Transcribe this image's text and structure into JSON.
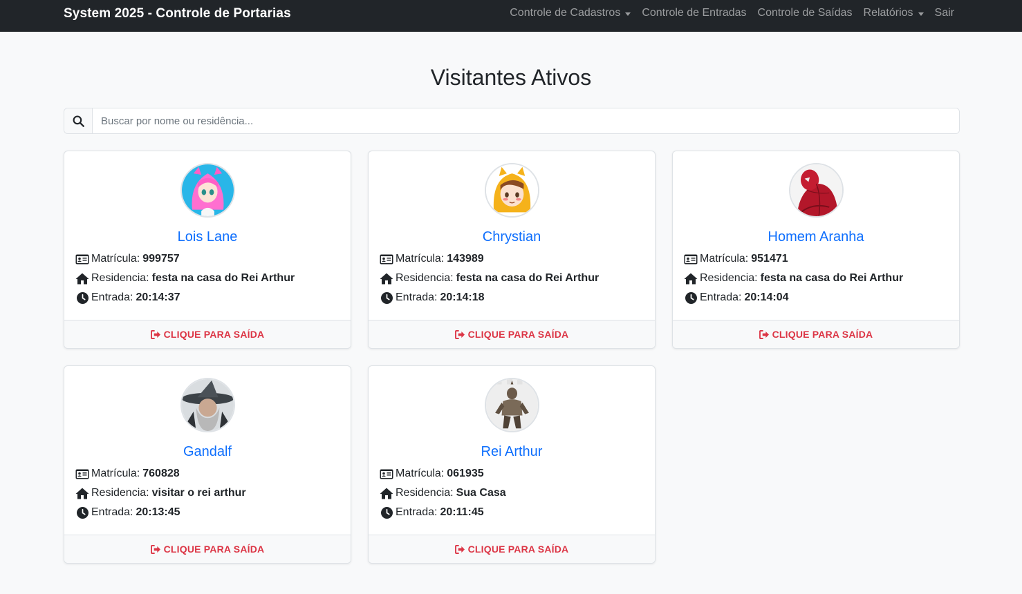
{
  "navbar": {
    "brand": "System 2025 - Controle de Portarias",
    "links": [
      {
        "label": "Controle de Cadastros",
        "dropdown": true
      },
      {
        "label": "Controle de Entradas",
        "dropdown": false
      },
      {
        "label": "Controle de Saídas",
        "dropdown": false
      },
      {
        "label": "Relatórios",
        "dropdown": true
      },
      {
        "label": "Sair",
        "dropdown": false
      }
    ]
  },
  "page": {
    "title": "Visitantes Ativos"
  },
  "search": {
    "placeholder": "Buscar por nome ou residência...",
    "value": ""
  },
  "labels": {
    "matricula": "Matrícula:",
    "residencia": "Residencia:",
    "entrada": "Entrada:",
    "exit_button": "CLIQUE PARA SAÍDA"
  },
  "visitors": [
    {
      "name": "Lois Lane",
      "matricula": "999757",
      "residencia": "festa na casa do Rei Arthur",
      "entrada": "20:14:37",
      "avatar": "pink-hair-character"
    },
    {
      "name": "Chrystian",
      "matricula": "143989",
      "residencia": "festa na casa do Rei Arthur",
      "entrada": "20:14:18",
      "avatar": "yellow-hood-character"
    },
    {
      "name": "Homem Aranha",
      "matricula": "951471",
      "residencia": "festa na casa do Rei Arthur",
      "entrada": "20:14:04",
      "avatar": "spider-man"
    },
    {
      "name": "Gandalf",
      "matricula": "760828",
      "residencia": "visitar o rei arthur",
      "entrada": "20:13:45",
      "avatar": "wizard-hat"
    },
    {
      "name": "Rei Arthur",
      "matricula": "061935",
      "residencia": "Sua Casa",
      "entrada": "20:11:45",
      "avatar": "knight-armor"
    }
  ],
  "colors": {
    "navbar_bg": "#212529",
    "link_blue": "#0d6efd",
    "danger_red": "#dc3545",
    "page_bg": "#f8f9fa"
  }
}
